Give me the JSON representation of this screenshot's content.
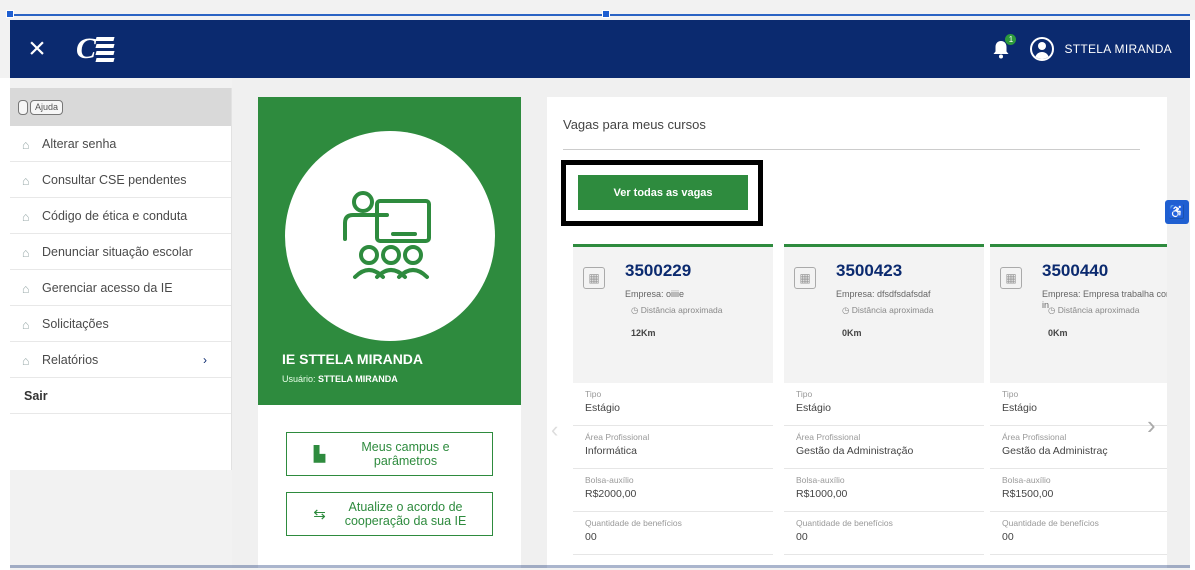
{
  "header": {
    "user_name": "STTELA MIRANDA",
    "notification_count": "1",
    "brand_color": "#0b2a6f"
  },
  "sidebar": {
    "top_tags": [
      "",
      "Ajuda"
    ],
    "items": [
      {
        "label": "Alterar senha"
      },
      {
        "label": "Consultar CSE pendentes"
      },
      {
        "label": "Código de ética e conduta"
      },
      {
        "label": "Denunciar situação escolar"
      },
      {
        "label": "Gerenciar acesso da IE"
      },
      {
        "label": "Solicitações"
      },
      {
        "label": "Relatórios",
        "arrow": "›"
      }
    ],
    "logout": "Sair"
  },
  "profile": {
    "name": "IE STTELA MIRANDA",
    "user_label": "Usuário:",
    "user_value": "STTELA MIRANDA",
    "accent": "#2e8b3e"
  },
  "actions": {
    "campus": "Meus campus e parâmetros",
    "agreement": "Atualize o acordo de cooperação da sua IE"
  },
  "vagas": {
    "title": "Vagas para meus cursos",
    "see_all": "Ver todas as vagas",
    "labels": {
      "tipo": "Tipo",
      "area": "Área Profissional",
      "bolsa": "Bolsa-auxílio",
      "qtd": "Quantidade de benefícios",
      "distancia": "Distância aproximada"
    },
    "cards": [
      {
        "code": "3500229",
        "empresa": "Empresa: oiiiie",
        "distancia_valor": "12Km",
        "tipo": "Estágio",
        "area": "Informática",
        "bolsa": "R$2000,00",
        "qtd": "00"
      },
      {
        "code": "3500423",
        "empresa": "Empresa: dfsdfsdafsdaf",
        "distancia_valor": "0Km",
        "tipo": "Estágio",
        "area": "Gestão da Administração",
        "bolsa": "R$1000,00",
        "qtd": "00"
      },
      {
        "code": "3500440",
        "empresa": "Empresa: Empresa trabalha com a in",
        "distancia_valor": "0Km",
        "tipo": "Estágio",
        "area": "Gestão da Administraç",
        "bolsa": "R$1500,00",
        "qtd": "00"
      }
    ]
  }
}
